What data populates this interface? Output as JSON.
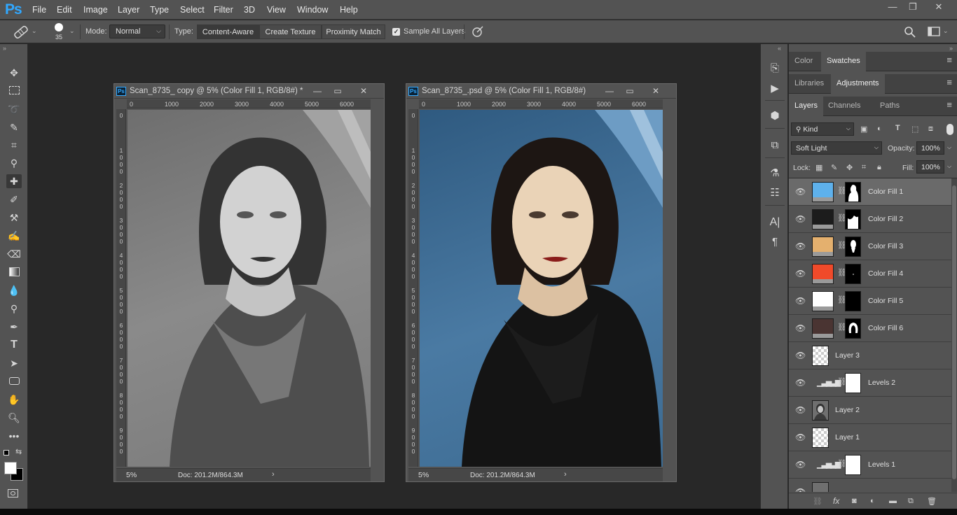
{
  "app": {
    "logo": "Ps"
  },
  "menu": [
    "File",
    "Edit",
    "Image",
    "Layer",
    "Type",
    "Select",
    "Filter",
    "3D",
    "View",
    "Window",
    "Help"
  ],
  "window_controls": {
    "minimize": "—",
    "restore": "❐",
    "close": "✕"
  },
  "options": {
    "brush_size": "35",
    "mode_label": "Mode:",
    "mode_value": "Normal",
    "type_label": "Type:",
    "type_buttons": [
      "Content-Aware",
      "Create Texture",
      "Proximity Match"
    ],
    "sample_all_layers": "Sample All Layers"
  },
  "documents": [
    {
      "title": "Scan_8735_ copy @ 5% (Color Fill 1, RGB/8#) *",
      "ruler_h": [
        "0",
        "1000",
        "2000",
        "3000",
        "4000",
        "5000",
        "6000"
      ],
      "ruler_v": [
        "0",
        "1\n0\n0\n0",
        "2\n0\n0\n0",
        "3\n0\n0\n0",
        "4\n0\n0\n0",
        "5\n0\n0\n0",
        "6\n0\n0\n0",
        "7\n0\n0\n0",
        "8\n0\n0\n0",
        "9\n0\n0\n0"
      ],
      "zoom": "5%",
      "doc_size": "Doc: 201.2M/864.3M"
    },
    {
      "title": "Scan_8735_.psd @ 5% (Color Fill 1, RGB/8#)",
      "ruler_h": [
        "0",
        "1000",
        "2000",
        "3000",
        "4000",
        "5000",
        "6000"
      ],
      "ruler_v": [
        "0",
        "1\n0\n0\n0",
        "2\n0\n0\n0",
        "3\n0\n0\n0",
        "4\n0\n0\n0",
        "5\n0\n0\n0",
        "6\n0\n0\n0",
        "7\n0\n0\n0",
        "8\n0\n0\n0",
        "9\n0\n0\n0"
      ],
      "zoom": "5%",
      "doc_size": "Doc: 201.2M/864.3M"
    }
  ],
  "panels": {
    "tabs_row1": [
      "Color",
      "Swatches"
    ],
    "tabs_row2": [
      "Libraries",
      "Adjustments"
    ],
    "tabs_row3": [
      "Layers",
      "Channels",
      "Paths"
    ]
  },
  "layers_panel": {
    "filter_kind": "Kind",
    "blend_mode": "Soft Light",
    "opacity_label": "Opacity:",
    "opacity_value": "100%",
    "lock_label": "Lock:",
    "fill_label": "Fill:",
    "fill_value": "100%",
    "layers": [
      {
        "name": "Color Fill 1",
        "color": "#5eb1ec",
        "kind": "fill",
        "selected": true
      },
      {
        "name": "Color Fill 2",
        "color": "#1c1c1c",
        "kind": "fill"
      },
      {
        "name": "Color Fill 3",
        "color": "#e4b06e",
        "kind": "fill"
      },
      {
        "name": "Color Fill 4",
        "color": "#f04a2a",
        "kind": "fill"
      },
      {
        "name": "Color Fill 5",
        "color": "#ffffff",
        "kind": "fill"
      },
      {
        "name": "Color Fill 6",
        "color": "#4a3432",
        "kind": "fill"
      },
      {
        "name": "Layer 3",
        "kind": "transparent"
      },
      {
        "name": "Levels 2",
        "kind": "levels"
      },
      {
        "name": "Layer 2",
        "kind": "photo"
      },
      {
        "name": "Layer 1",
        "kind": "transparent"
      },
      {
        "name": "Levels 1",
        "kind": "levels"
      }
    ]
  }
}
